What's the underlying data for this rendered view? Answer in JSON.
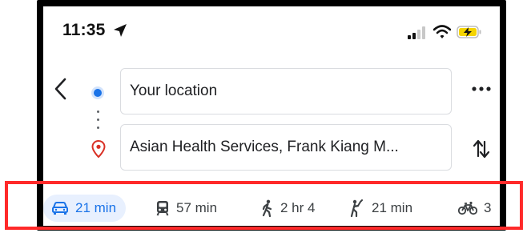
{
  "status_bar": {
    "time": "11:35"
  },
  "directions": {
    "origin": "Your location",
    "destination": "Asian Health Services, Frank Kiang M..."
  },
  "modes": [
    {
      "name": "drive",
      "label": "21 min",
      "active": true
    },
    {
      "name": "transit",
      "label": "57 min",
      "active": false
    },
    {
      "name": "walk",
      "label": "2 hr 4",
      "active": false
    },
    {
      "name": "rideshare",
      "label": "21 min",
      "active": false
    },
    {
      "name": "bike",
      "label": "3",
      "active": false
    }
  ],
  "colors": {
    "accent": "#1a73e8",
    "active_bg": "#e8f0fe",
    "highlight": "#ff2a2a",
    "pin": "#d93025"
  }
}
